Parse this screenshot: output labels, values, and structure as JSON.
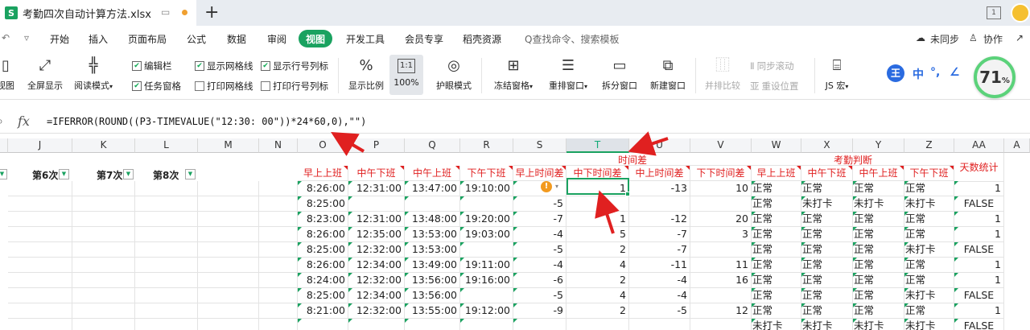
{
  "tab": {
    "logo": "S",
    "title": "考勤四次自动计算方法.xlsx",
    "screen_icon": "screen-icon",
    "page_indicator": "1"
  },
  "menu": {
    "items": [
      "开始",
      "插入",
      "页面布局",
      "公式",
      "数据",
      "审阅",
      "视图",
      "开发工具",
      "会员专享",
      "稻壳资源"
    ],
    "active": "视图",
    "search": "Q查找命令、搜索模板",
    "right": [
      "未同步",
      "协作"
    ]
  },
  "ribbon": {
    "big_buttons": [
      "视图",
      "全屏显示",
      "阅读模式",
      "显示比例",
      "100%",
      "护眼模式",
      "冻结窗格",
      "重排窗口",
      "拆分窗口",
      "新建窗口",
      "并排比较",
      "JS 宏"
    ],
    "checkboxes": [
      {
        "label": "编辑栏",
        "checked": true
      },
      {
        "label": "显示网格线",
        "checked": true
      },
      {
        "label": "显示行号列标",
        "checked": true
      },
      {
        "label": "任务窗格",
        "checked": true
      },
      {
        "label": "打印网格线",
        "checked": false
      },
      {
        "label": "打印行号列标",
        "checked": false
      }
    ],
    "sync_scroll": "同步滚动",
    "reset_position": "重设位置",
    "zoom_value": "71",
    "zoom_unit": "%",
    "ime": [
      "王",
      "中",
      "°,",
      "∠"
    ]
  },
  "formula_bar": {
    "label": "fx",
    "formula": "=IFERROR(ROUND((P3-TIMEVALUE(\"12:30: 00\"))*24*60,0),\"\")"
  },
  "columns": [
    "J",
    "K",
    "L",
    "M",
    "N",
    "O",
    "P",
    "Q",
    "R",
    "S",
    "T",
    "U",
    "V",
    "W",
    "X",
    "Y",
    "Z",
    "AA",
    "A"
  ],
  "selected_column": "T",
  "filters": [
    "第6次",
    "第7次",
    "第8次"
  ],
  "group_headers": {
    "time_diff": "时间差",
    "attendance": "考勤判断",
    "days": "天数统计"
  },
  "headers": [
    "早上上班",
    "中午下班",
    "中午上班",
    "下午下班",
    "早上时间差",
    "中下时间差",
    "中上时间差",
    "下下时间差",
    "早上上班",
    "中午下班",
    "中午上班",
    "下午下班"
  ],
  "rows": [
    {
      "O": "8:26:00",
      "P": "12:31:00",
      "Q": "13:47:00",
      "R": "19:10:00",
      "S": "",
      "T": "1",
      "U": "-13",
      "V": "10",
      "W": "正常",
      "X": "正常",
      "Y": "正常",
      "Z": "正常",
      "AA": "1"
    },
    {
      "O": "8:25:00",
      "P": "",
      "Q": "",
      "R": "",
      "S": "-5",
      "T": "",
      "U": "",
      "V": "",
      "W": "正常",
      "X": "未打卡",
      "Y": "未打卡",
      "Z": "未打卡",
      "AA": "FALSE"
    },
    {
      "O": "8:23:00",
      "P": "12:31:00",
      "Q": "13:48:00",
      "R": "19:20:00",
      "S": "-7",
      "T": "1",
      "U": "-12",
      "V": "20",
      "W": "正常",
      "X": "正常",
      "Y": "正常",
      "Z": "正常",
      "AA": "1"
    },
    {
      "O": "8:26:00",
      "P": "12:35:00",
      "Q": "13:53:00",
      "R": "19:03:00",
      "S": "-4",
      "T": "5",
      "U": "-7",
      "V": "3",
      "W": "正常",
      "X": "正常",
      "Y": "正常",
      "Z": "正常",
      "AA": "1"
    },
    {
      "O": "8:25:00",
      "P": "12:32:00",
      "Q": "13:53:00",
      "R": "",
      "S": "-5",
      "T": "2",
      "U": "-7",
      "V": "",
      "W": "正常",
      "X": "正常",
      "Y": "正常",
      "Z": "未打卡",
      "AA": "FALSE"
    },
    {
      "O": "8:26:00",
      "P": "12:34:00",
      "Q": "13:49:00",
      "R": "19:11:00",
      "S": "-4",
      "T": "4",
      "U": "-11",
      "V": "11",
      "W": "正常",
      "X": "正常",
      "Y": "正常",
      "Z": "正常",
      "AA": "1"
    },
    {
      "O": "8:24:00",
      "P": "12:32:00",
      "Q": "13:56:00",
      "R": "19:16:00",
      "S": "-6",
      "T": "2",
      "U": "-4",
      "V": "16",
      "W": "正常",
      "X": "正常",
      "Y": "正常",
      "Z": "正常",
      "AA": "1"
    },
    {
      "O": "8:25:00",
      "P": "12:34:00",
      "Q": "13:56:00",
      "R": "",
      "S": "-5",
      "T": "4",
      "U": "-4",
      "V": "",
      "W": "正常",
      "X": "正常",
      "Y": "正常",
      "Z": "未打卡",
      "AA": "FALSE"
    },
    {
      "O": "8:21:00",
      "P": "12:32:00",
      "Q": "13:55:00",
      "R": "19:12:00",
      "S": "-9",
      "T": "2",
      "U": "-5",
      "V": "12",
      "W": "正常",
      "X": "正常",
      "Y": "正常",
      "Z": "正常",
      "AA": "1"
    },
    {
      "O": "",
      "P": "",
      "Q": "",
      "R": "",
      "S": "",
      "T": "",
      "U": "",
      "V": "",
      "W": "未打卡",
      "X": "未打卡",
      "Y": "未打卡",
      "Z": "未打卡",
      "AA": "FALSE"
    }
  ],
  "colors": {
    "accent": "#1aa260",
    "red": "#e02020",
    "warn": "#f29a1f"
  }
}
